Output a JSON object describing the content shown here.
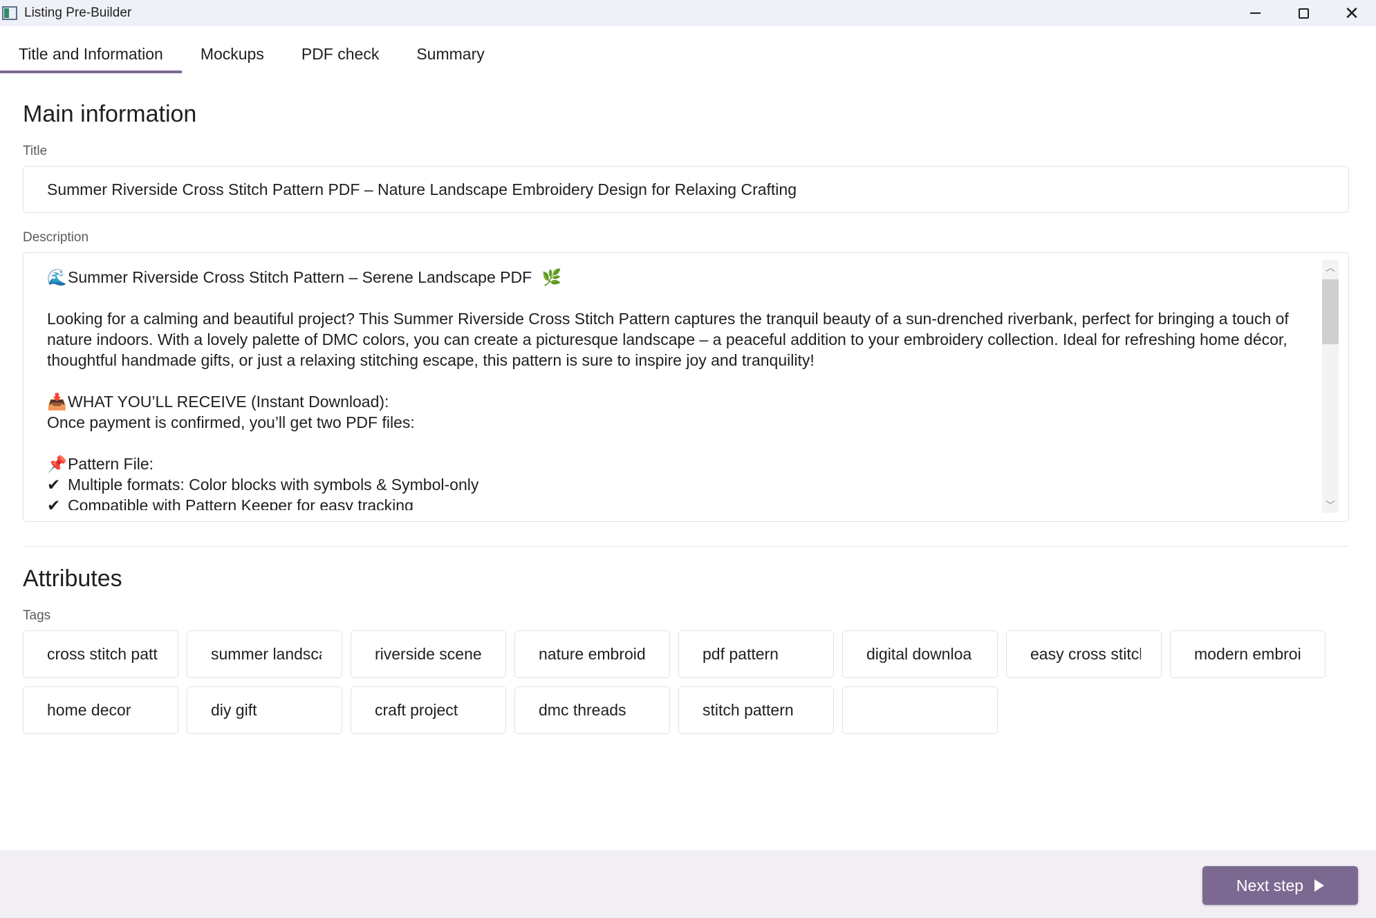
{
  "window": {
    "title": "Listing Pre-Builder",
    "minimize_glyph": "—",
    "close_glyph": "✕"
  },
  "tabs": [
    {
      "label": "Title and Information",
      "active": true
    },
    {
      "label": "Mockups",
      "active": false
    },
    {
      "label": "PDF check",
      "active": false
    },
    {
      "label": "Summary",
      "active": false
    }
  ],
  "main": {
    "heading": "Main information",
    "title_label": "Title",
    "title_value": "Summer Riverside Cross Stitch Pattern PDF – Nature Landscape Embroidery Design for Relaxing Crafting",
    "description_label": "Description",
    "description": {
      "line1_icon": "🌊",
      "line1_text": "Summer Riverside Cross Stitch Pattern – Serene Landscape PDF",
      "line1_trail_icon": "🌿",
      "para": "Looking for a calming and beautiful project? This Summer Riverside Cross Stitch Pattern captures the tranquil beauty of a sun-drenched riverbank, perfect for bringing a touch of nature indoors. With a lovely palette of DMC colors, you can create a picturesque landscape – a peaceful addition to your embroidery collection. Ideal for refreshing home décor, thoughtful handmade gifts, or just a relaxing stitching escape, this pattern is sure to inspire joy and tranquility!",
      "receive_icon": "📥",
      "receive_text": "WHAT YOU’LL RECEIVE (Instant Download):",
      "payment_text": "Once payment is confirmed, you’ll get two PDF files:",
      "pattern_icon": "📌",
      "pattern_text": "Pattern File:",
      "check_icon": "✔",
      "bullet1": "Multiple formats: Color blocks with symbols & Symbol-only",
      "bullet2": "Compatible with Pattern Keeper for easy tracking"
    }
  },
  "attributes": {
    "heading": "Attributes",
    "tags_label": "Tags",
    "tags": [
      "cross stitch patt",
      "summer landsca",
      "riverside scene",
      "nature embroid",
      "pdf pattern",
      "digital downloa",
      "easy cross stitch",
      "modern embroi",
      "home decor",
      "diy gift",
      "craft project",
      "dmc threads",
      "stitch pattern",
      ""
    ]
  },
  "footer": {
    "next_label": "Next step"
  },
  "colors": {
    "accent": "#7b6991",
    "titlebar": "#eff1f8",
    "footer": "#f2eff4"
  }
}
